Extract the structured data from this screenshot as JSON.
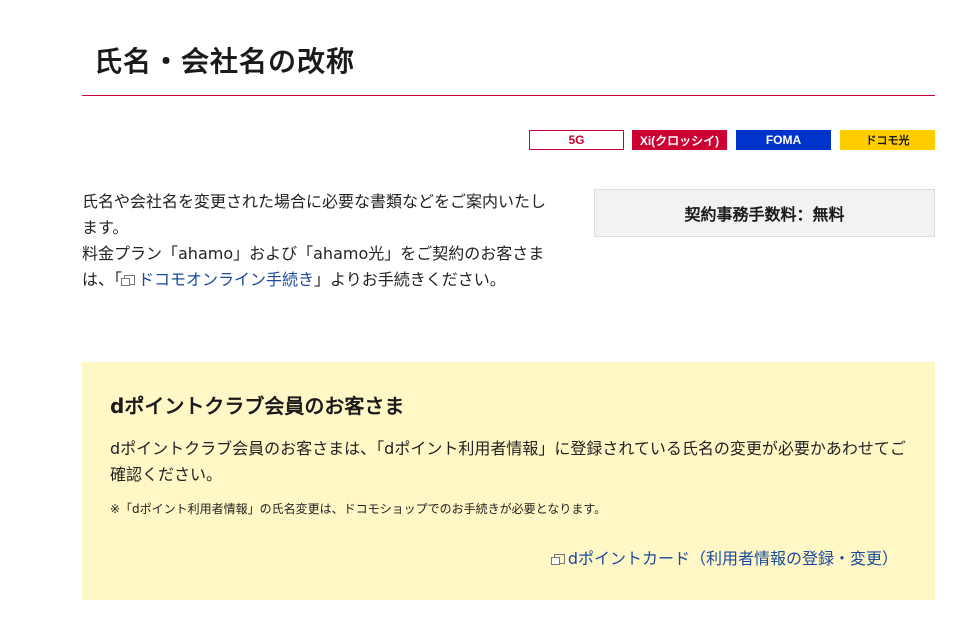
{
  "page": {
    "title": "氏名・会社名の改称"
  },
  "badges": [
    {
      "label": "5G"
    },
    {
      "label": "Xi(クロッシイ)"
    },
    {
      "label": "FOMA"
    },
    {
      "label": "ドコモ光"
    }
  ],
  "intro": {
    "line1": "氏名や会社名を変更された場合に必要な書類などをご案内いたします。",
    "line2_prefix": "料金プラン「ahamo」および「ahamo光」をご契約のお客さまは、「",
    "line2_link": "ドコモオンライン手続き",
    "line2_suffix": "」よりお手続きください。"
  },
  "fee": {
    "label": "契約事務手数料：無料"
  },
  "notice": {
    "title": "dポイントクラブ会員のお客さま",
    "body": "dポイントクラブ会員のお客さまは、「dポイント利用者情報」に登録されている氏名の変更が必要かあわせてご確認ください。",
    "note": "※「dポイント利用者情報」の氏名変更は、ドコモショップでのお手続きが必要となります。",
    "link": "dポイントカード（利用者情報の登録・変更）"
  },
  "colors": {
    "accent_red": "#cc0033",
    "foma_blue": "#0033cc",
    "hikari_yellow": "#ffcc00",
    "notice_bg": "#fff8c6",
    "link": "#1a4a9c"
  },
  "icons": {
    "external_link": "external-link-icon"
  }
}
